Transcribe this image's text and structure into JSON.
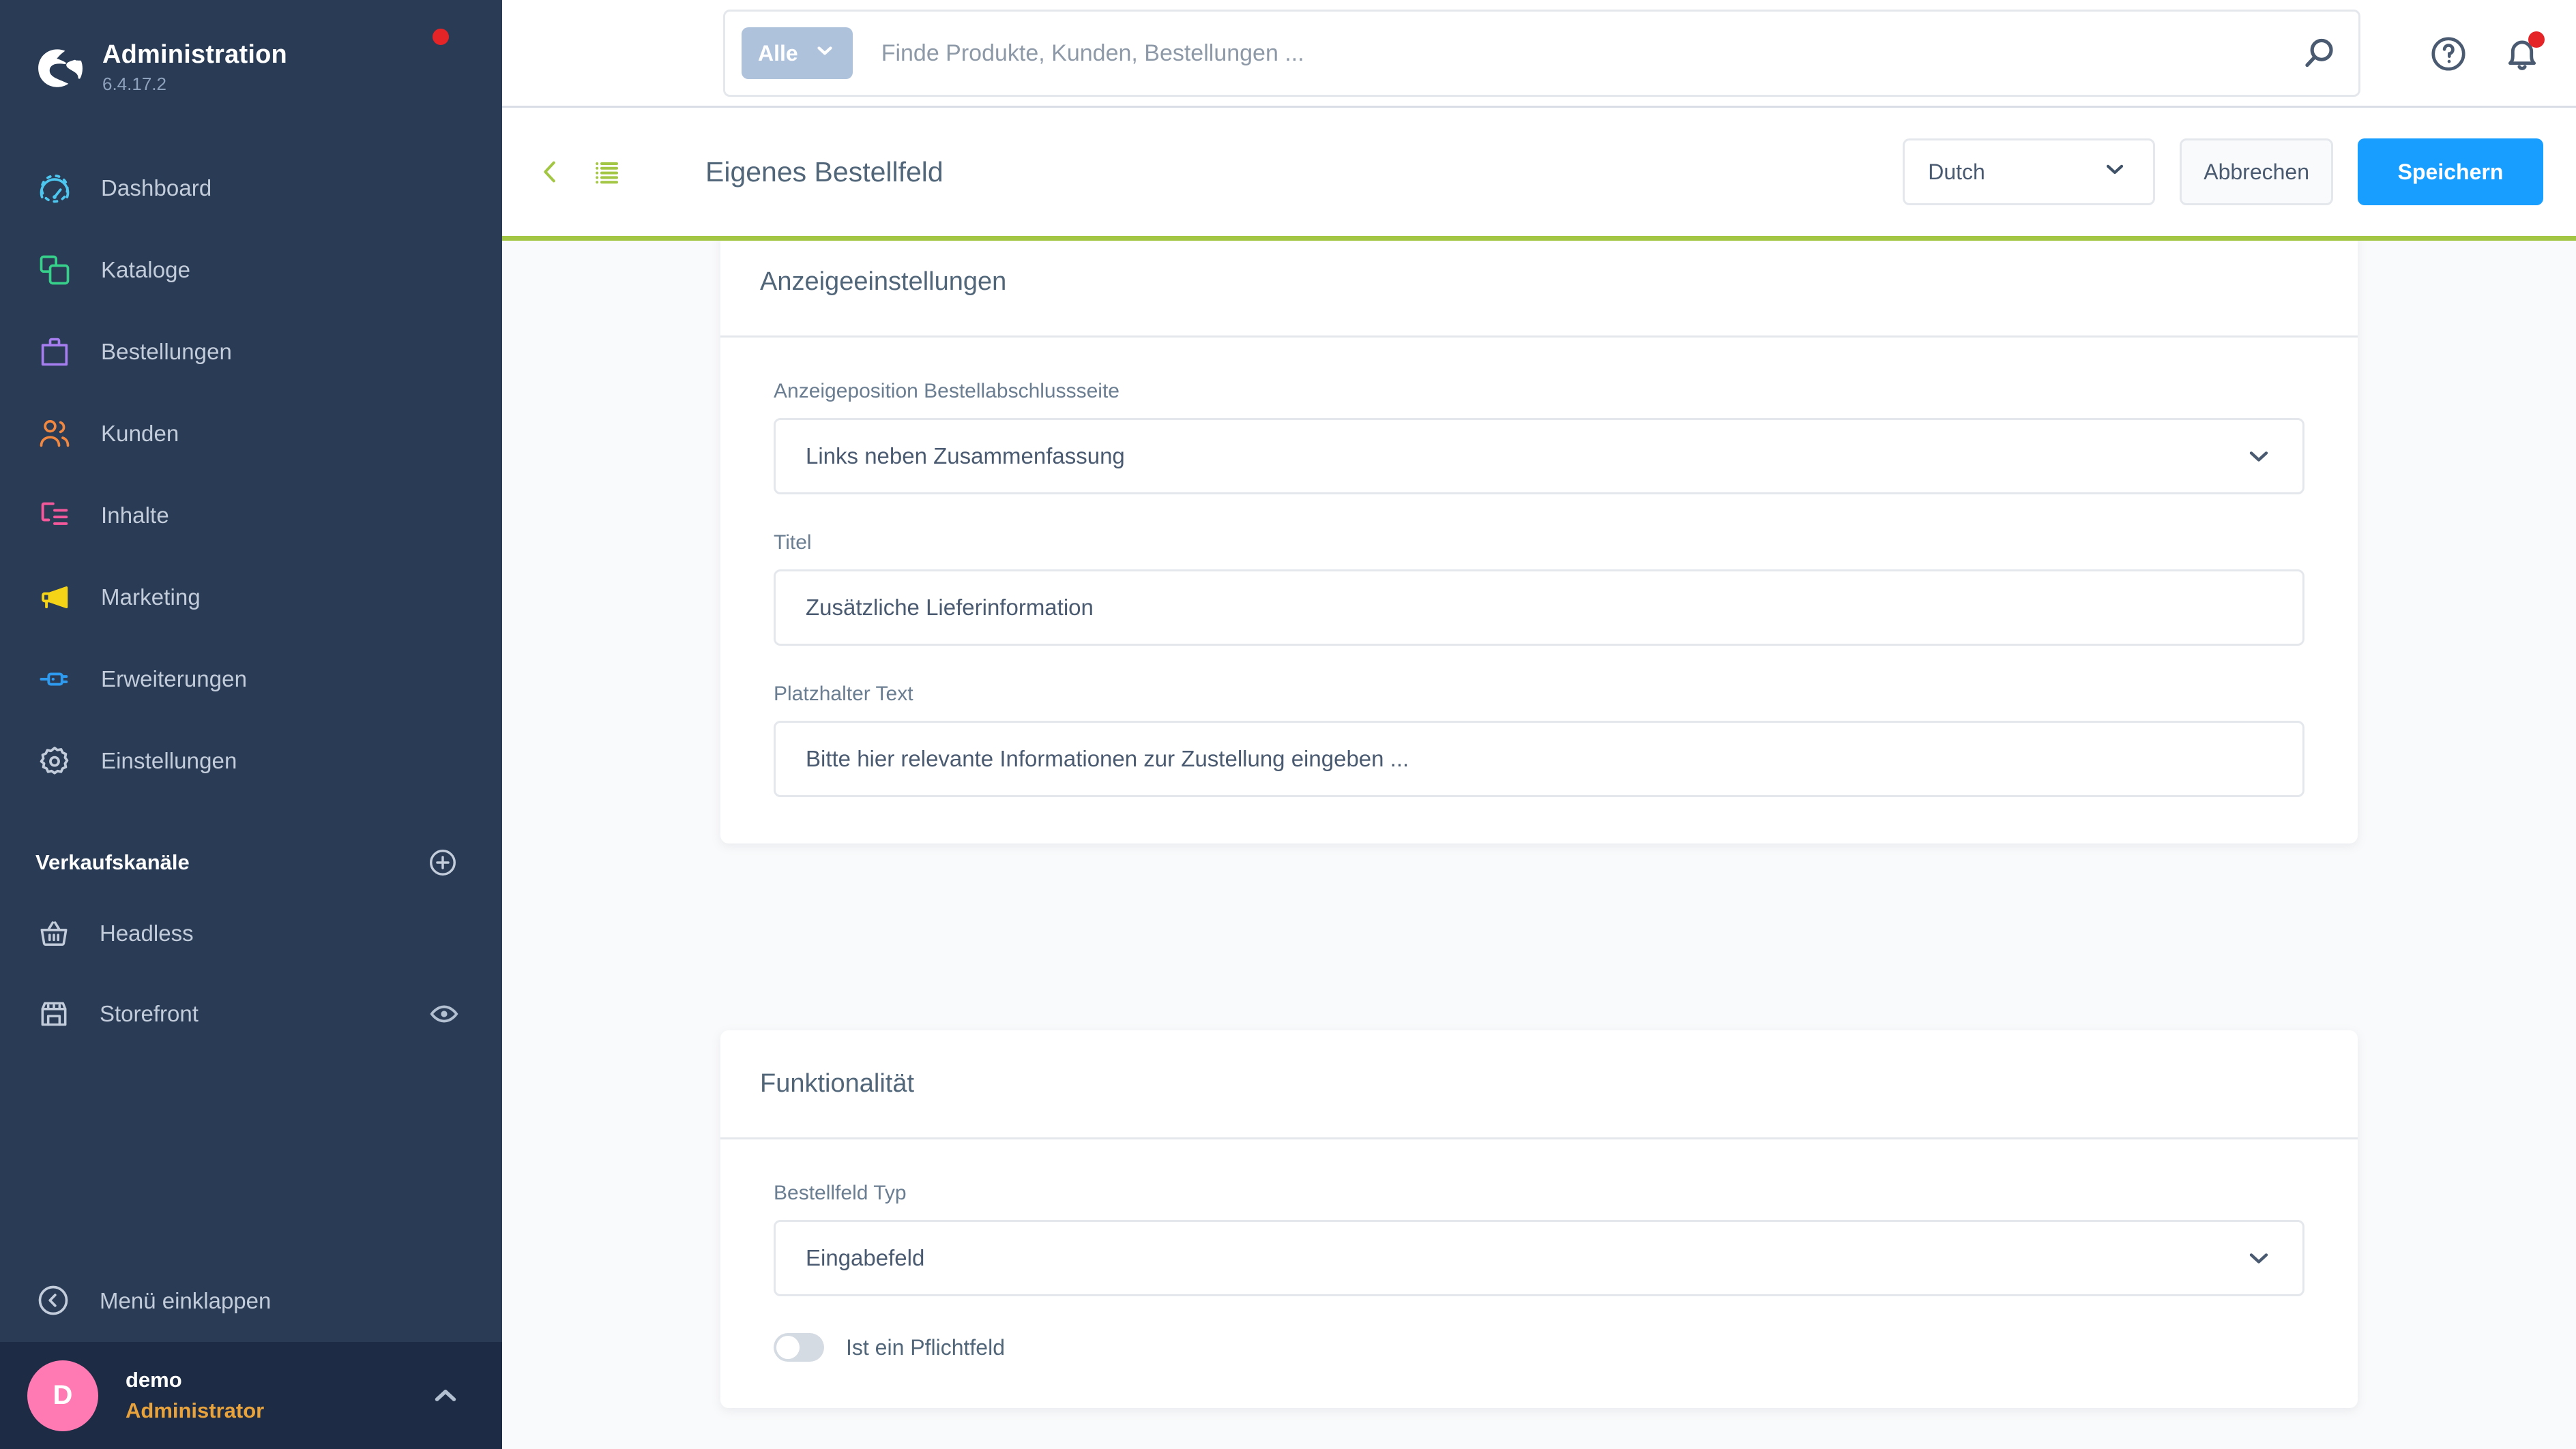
{
  "sidebar": {
    "brand": {
      "title": "Administration",
      "version": "6.4.17.2"
    },
    "nav_items": [
      {
        "label": "Dashboard",
        "icon": "gauge-icon",
        "color": "#4dc7f0"
      },
      {
        "label": "Kataloge",
        "icon": "catalog-icon",
        "color": "#37d08a"
      },
      {
        "label": "Bestellungen",
        "icon": "bag-icon",
        "color": "#a77ef0"
      },
      {
        "label": "Kunden",
        "icon": "users-icon",
        "color": "#f2873f"
      },
      {
        "label": "Inhalte",
        "icon": "content-icon",
        "color": "#f5589b"
      },
      {
        "label": "Marketing",
        "icon": "megaphone-icon",
        "color": "#f5d316"
      },
      {
        "label": "Erweiterungen",
        "icon": "plug-icon",
        "color": "#2f9bf0"
      },
      {
        "label": "Einstellungen",
        "icon": "gear-icon",
        "color": "#c2ccda"
      }
    ],
    "sales_channels": {
      "title": "Verkaufskanäle",
      "add_label": "+",
      "items": [
        {
          "label": "Headless",
          "icon": "basket-icon",
          "has_eye": false
        },
        {
          "label": "Storefront",
          "icon": "storefront-icon",
          "has_eye": true
        }
      ]
    },
    "collapse_label": "Menü einklappen",
    "user": {
      "initial": "D",
      "name": "demo",
      "role": "Administrator"
    }
  },
  "topbar": {
    "scope_label": "Alle",
    "search_placeholder": "Finde Produkte, Kunden, Bestellungen ...",
    "search_value": "",
    "help_icon": "question-circle-icon",
    "notification_icon": "bell-icon"
  },
  "pagehead": {
    "title": "Eigenes Bestellfeld",
    "back_icon": "chevron-left-icon",
    "list_icon": "list-icon",
    "language": "Dutch",
    "cancel_label": "Abbrechen",
    "save_label": "Speichern"
  },
  "cards": [
    {
      "title": "Anzeigeeinstellungen",
      "fields": [
        {
          "label": "Anzeigeposition Bestellabschlussseite",
          "type": "select",
          "value": "Links neben Zusammenfassung"
        },
        {
          "label": "Titel",
          "type": "text",
          "value": "Zusätzliche Lieferinformation"
        },
        {
          "label": "Platzhalter Text",
          "type": "text",
          "value": "Bitte hier relevante Informationen zur Zustellung eingeben ..."
        }
      ]
    },
    {
      "title": "Funktionalität",
      "fields": [
        {
          "label": "Bestellfeld Typ",
          "type": "select",
          "value": "Eingabefeld"
        }
      ],
      "toggle": {
        "label": "Ist ein Pflichtfeld",
        "on": false
      }
    }
  ],
  "colors": {
    "sidebar_bg": "#2a3b55",
    "accent_green": "#a3c644",
    "primary_blue": "#189eff",
    "notification_red": "#e52427",
    "avatar_pink": "#ff7ab2",
    "role_orange": "#e8a33d"
  }
}
